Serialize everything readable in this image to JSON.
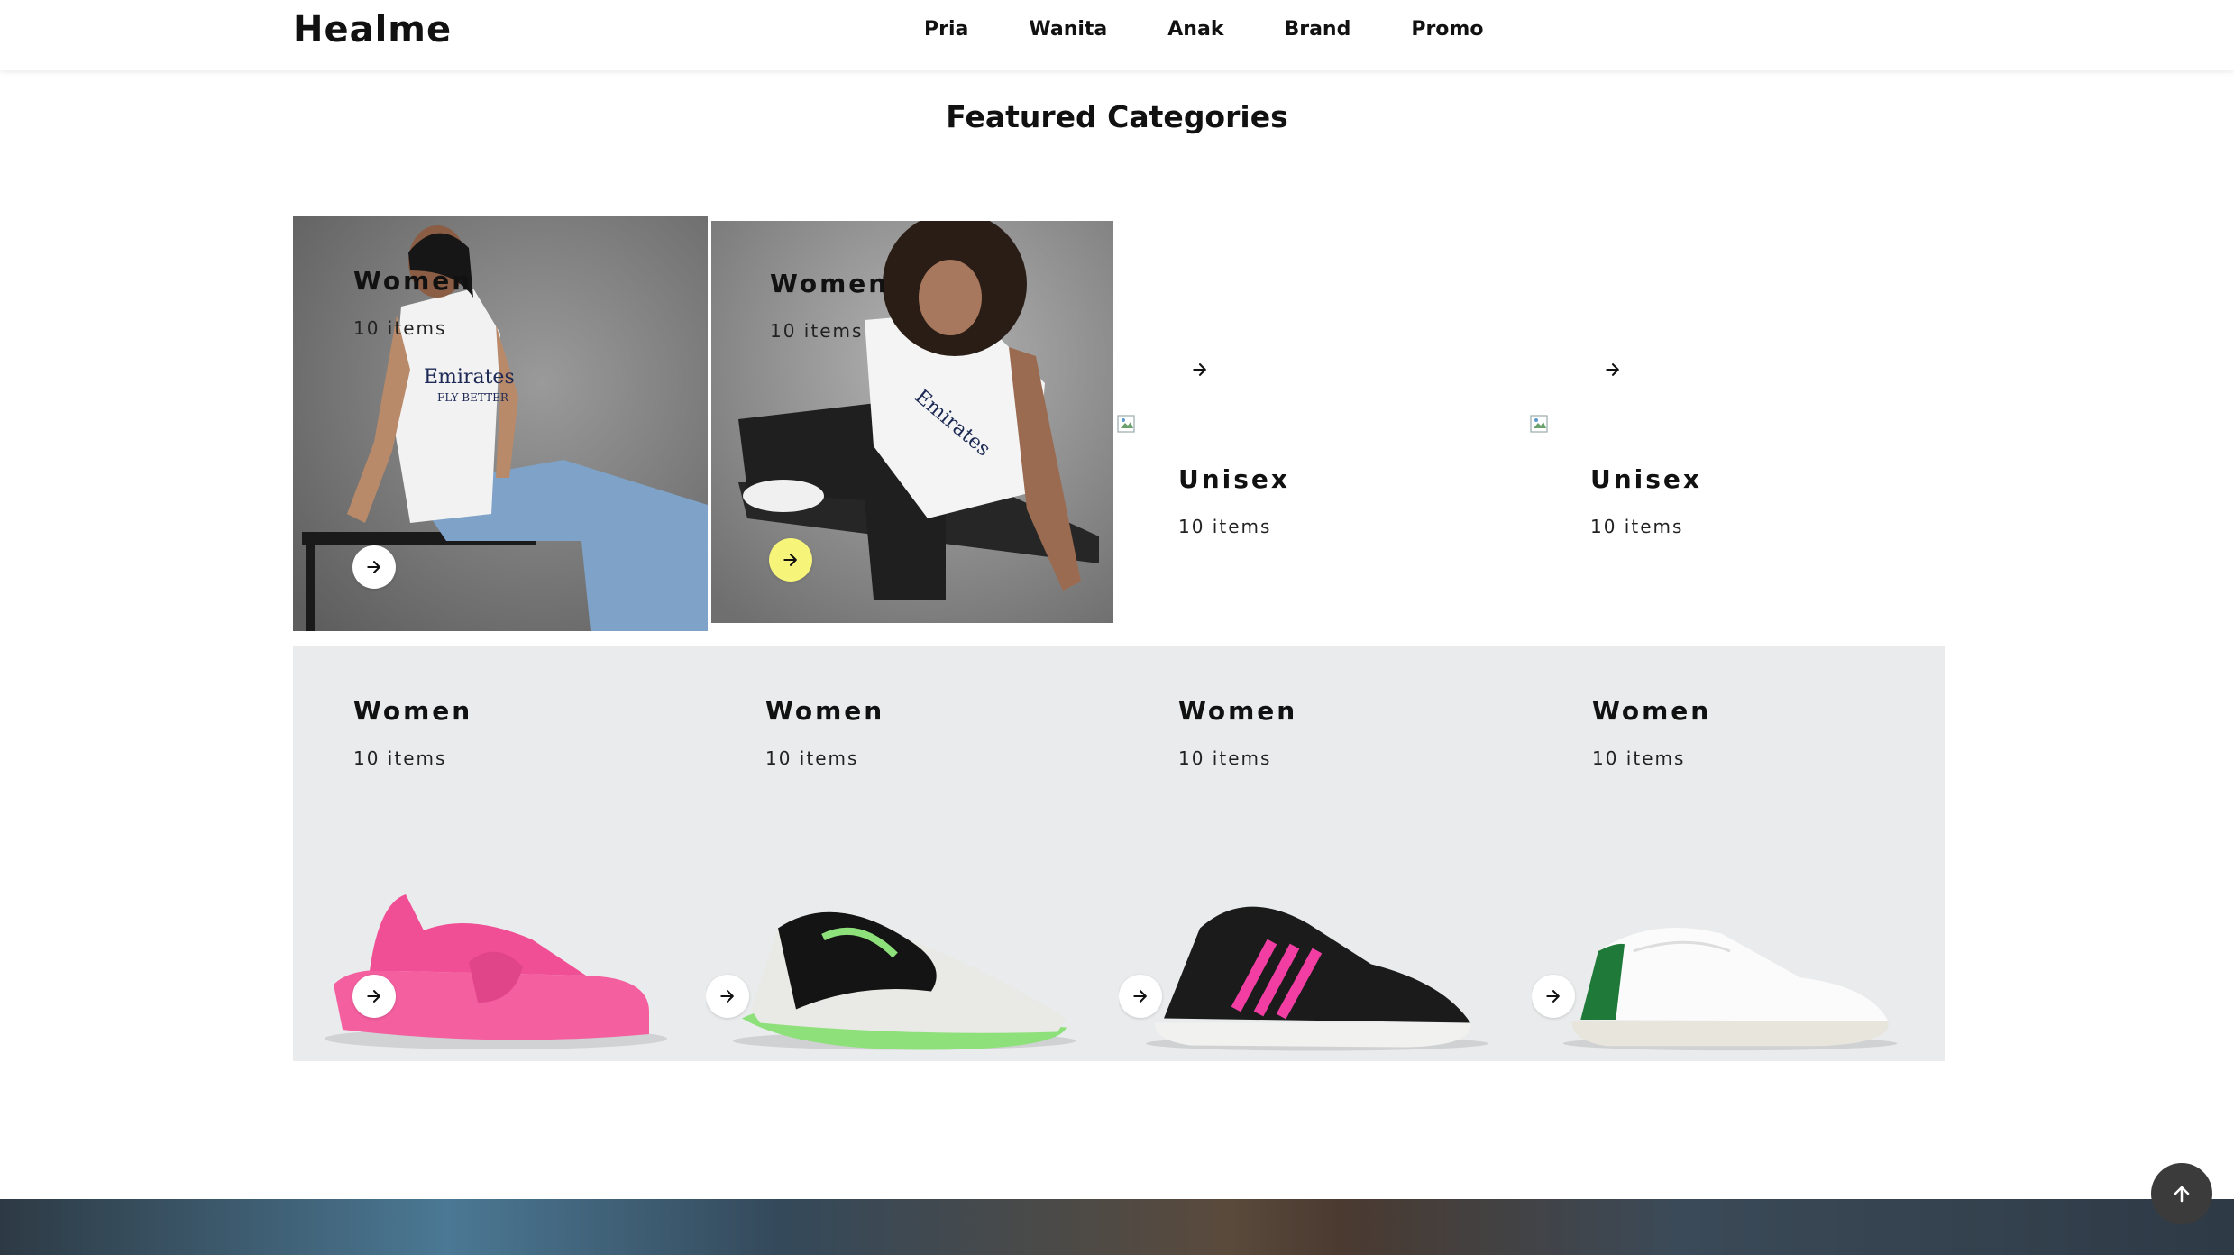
{
  "header": {
    "logo": "Healme",
    "nav": [
      "Pria",
      "Wanita",
      "Anak",
      "Brand",
      "Promo"
    ]
  },
  "section": {
    "title": "Featured Categories"
  },
  "top_row": [
    {
      "title": "Women",
      "count": "10 items"
    },
    {
      "title": "Women",
      "count": "10 items"
    },
    {
      "title": "Unisex",
      "count": "10 items"
    },
    {
      "title": "Unisex",
      "count": "10 items"
    }
  ],
  "shoe_row": [
    {
      "title": "Women",
      "count": "10 items"
    },
    {
      "title": "Women",
      "count": "10 items"
    },
    {
      "title": "Women",
      "count": "10 items"
    },
    {
      "title": "Women",
      "count": "10 items"
    }
  ],
  "icons": {
    "card_arrow": "arrow-right-icon",
    "scroll_top": "arrow-up-icon",
    "broken_image": "broken-image-icon"
  },
  "colors": {
    "panel_bg": "#e9ebec",
    "highlight_button": "#f7f47a",
    "scroll_button": "#3b3b3b",
    "sandal": "#f45fa0"
  }
}
